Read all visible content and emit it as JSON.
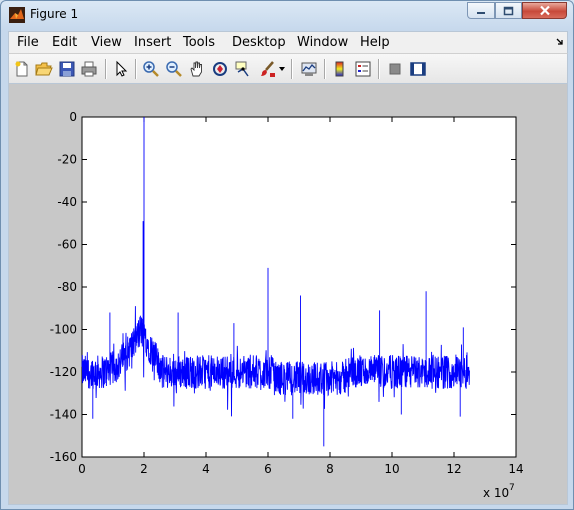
{
  "window": {
    "title": "Figure 1"
  },
  "menu": [
    "File",
    "Edit",
    "View",
    "Insert",
    "Tools",
    "Desktop",
    "Window",
    "Help"
  ],
  "toolbar_icons": [
    "new-figure-icon",
    "open-file-icon",
    "save-icon",
    "print-icon",
    "pointer-icon",
    "zoom-in-icon",
    "zoom-out-icon",
    "pan-hand-icon",
    "rotate-3d-icon",
    "data-cursor-icon",
    "brush-icon",
    "link-plot-icon",
    "colorbar-icon",
    "legend-icon",
    "hide-plot-tools-icon",
    "show-plot-tools-icon"
  ],
  "chart_data": {
    "type": "line",
    "title": "",
    "xlabel": "",
    "ylabel": "",
    "xlim": [
      0,
      14
    ],
    "ylim": [
      -160,
      0
    ],
    "x_multiplier_label": "x 10",
    "x_multiplier_exponent": "7",
    "xticks": [
      "0",
      "2",
      "4",
      "6",
      "8",
      "10",
      "12",
      "14"
    ],
    "yticks": [
      "0",
      "-20",
      "-40",
      "-60",
      "-80",
      "-100",
      "-120",
      "-140",
      "-160"
    ],
    "line_color": "#0000ff",
    "grid": false,
    "series": [
      {
        "x_range": [
          0,
          12.5
        ],
        "noise_floor": -120,
        "rise_to_carrier": {
          "x_start": 0.6,
          "x_end": 1.9,
          "from": -120,
          "to": -100
        },
        "spikes": [
          {
            "x": 2.0,
            "y": 0
          },
          {
            "x": 1.97,
            "y": -49
          },
          {
            "x": 0.9,
            "y": -92
          },
          {
            "x": 3.1,
            "y": -92
          },
          {
            "x": 4.9,
            "y": -97
          },
          {
            "x": 6.0,
            "y": -71
          },
          {
            "x": 7.05,
            "y": -84
          },
          {
            "x": 9.6,
            "y": -91
          },
          {
            "x": 11.1,
            "y": -82
          },
          {
            "x": 12.3,
            "y": -99
          }
        ],
        "dips": [
          {
            "x": 0.35,
            "y": -142
          },
          {
            "x": 7.8,
            "y": -155
          },
          {
            "x": 6.8,
            "y": -142
          },
          {
            "x": 10.3,
            "y": -140
          },
          {
            "x": 12.2,
            "y": -141
          }
        ]
      }
    ]
  }
}
